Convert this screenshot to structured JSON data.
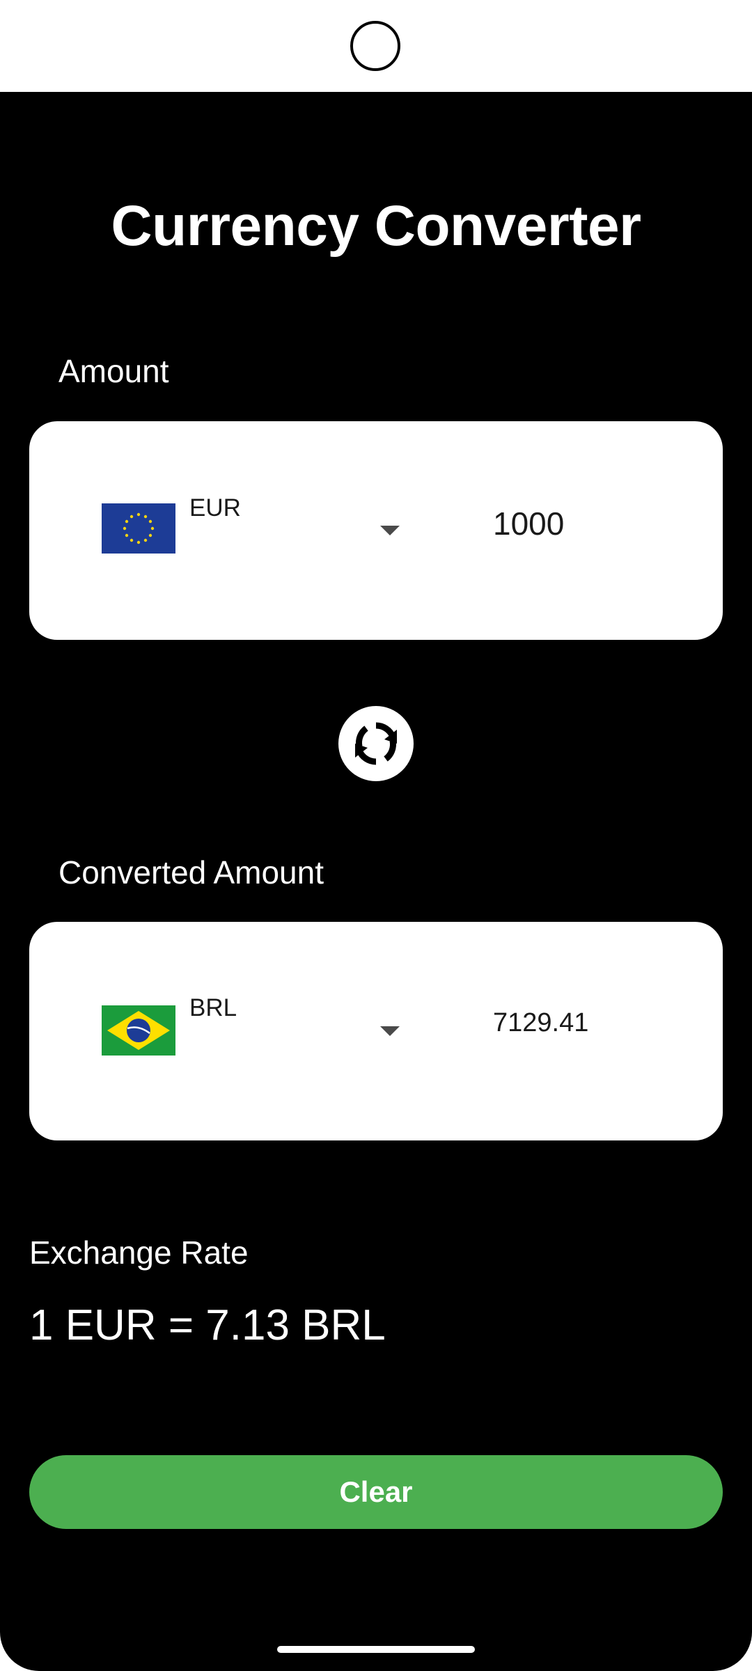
{
  "app": {
    "title": "Currency Converter"
  },
  "from": {
    "label": "Amount",
    "currency_code": "EUR",
    "flag_icon": "eu-flag-icon",
    "amount": "1000"
  },
  "swap": {
    "icon": "swap-refresh-icon"
  },
  "to": {
    "label": "Converted Amount",
    "currency_code": "BRL",
    "flag_icon": "brazil-flag-icon",
    "amount": "7129.41"
  },
  "exchange": {
    "label": "Exchange Rate",
    "value": "1 EUR = 7.13 BRL"
  },
  "actions": {
    "clear_label": "Clear"
  },
  "colors": {
    "background": "#000000",
    "card": "#ffffff",
    "accent_green": "#4caf50"
  }
}
